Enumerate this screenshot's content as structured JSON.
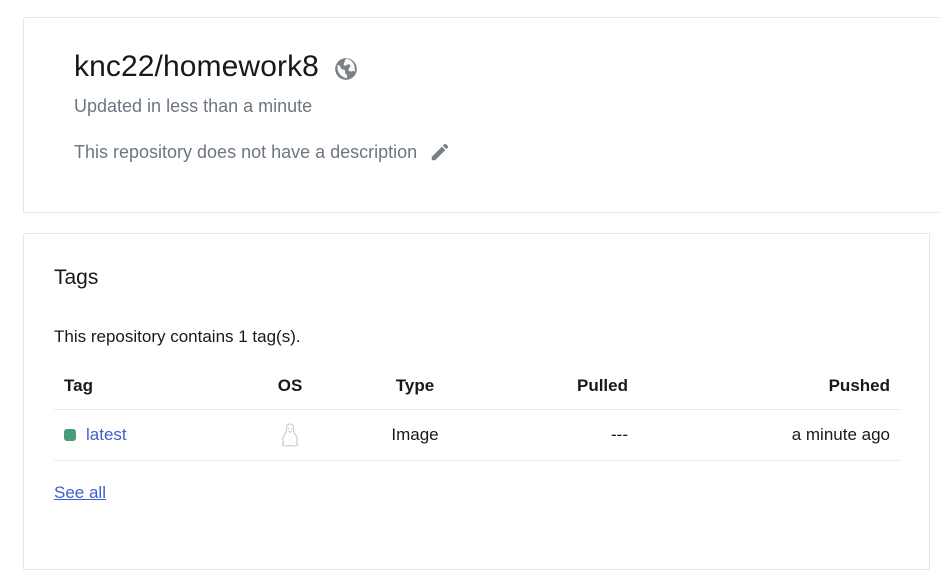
{
  "repo": {
    "name": "knc22/homework8",
    "visibility_icon": "globe-icon",
    "updated": "Updated in less than a minute",
    "description": "This repository does not have a description",
    "edit_icon": "pencil-icon"
  },
  "tags": {
    "heading": "Tags",
    "summary": "This repository contains 1 tag(s).",
    "columns": {
      "tag": "Tag",
      "os": "OS",
      "type": "Type",
      "pulled": "Pulled",
      "pushed": "Pushed"
    },
    "rows": [
      {
        "tag": "latest",
        "status_color": "#4b9a7a",
        "os_icon": "linux-icon",
        "type": "Image",
        "pulled": "---",
        "pushed": "a minute ago"
      }
    ],
    "see_all": "See all"
  },
  "colors": {
    "link": "#3f5fcf",
    "muted_text": "#6c7680",
    "border": "#e3e5e8"
  }
}
